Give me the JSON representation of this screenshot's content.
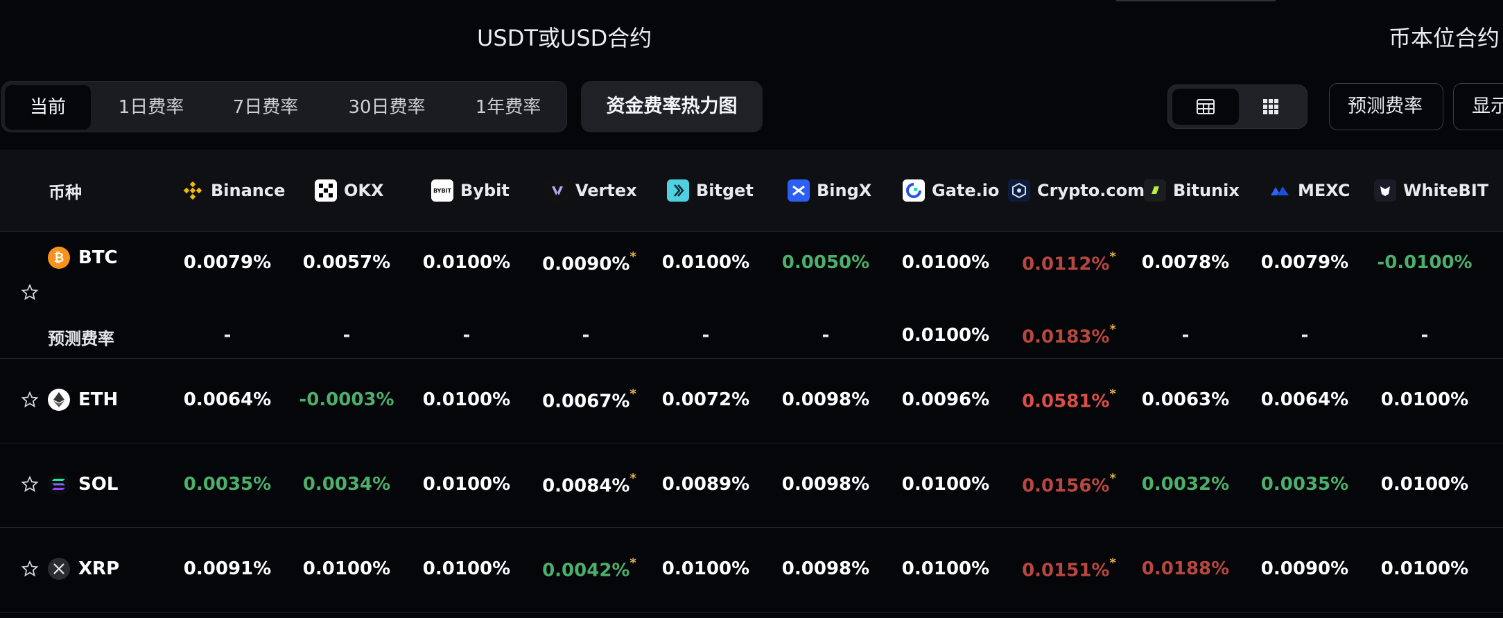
{
  "titles": {
    "usdt": "USDT或USD合约",
    "coin": "币本位合约"
  },
  "period_tabs": [
    "当前",
    "1日费率",
    "7日费率",
    "30日费率",
    "1年费率"
  ],
  "heatmap_button": "资金费率热力图",
  "predict_button": "预测费率",
  "display_button": "显示",
  "table": {
    "coin_header": "币种",
    "exchanges": [
      {
        "name": "Binance",
        "icon": "binance-icon"
      },
      {
        "name": "OKX",
        "icon": "okx-icon"
      },
      {
        "name": "Bybit",
        "icon": "bybit-icon"
      },
      {
        "name": "Vertex",
        "icon": "vertex-icon"
      },
      {
        "name": "Bitget",
        "icon": "bitget-icon"
      },
      {
        "name": "BingX",
        "icon": "bingx-icon"
      },
      {
        "name": "Gate.io",
        "icon": "gateio-icon"
      },
      {
        "name": "Crypto.com",
        "icon": "cryptocom-icon"
      },
      {
        "name": "Bitunix",
        "icon": "bitunix-icon"
      },
      {
        "name": "MEXC",
        "icon": "mexc-icon"
      },
      {
        "name": "WhiteBIT",
        "icon": "whitebit-icon"
      }
    ],
    "predict_label": "预测费率",
    "rows": [
      {
        "symbol": "BTC",
        "rates": [
          "0.0079%",
          "0.0057%",
          "0.0100%",
          "0.0090%",
          "0.0100%",
          "0.0050%",
          "0.0100%",
          "0.0112%",
          "0.0078%",
          "0.0079%",
          "-0.0100%"
        ],
        "predicted": [
          "-",
          "-",
          "-",
          "-",
          "-",
          "-",
          "0.0100%",
          "0.0183%",
          "-",
          "-",
          "-"
        ]
      },
      {
        "symbol": "ETH",
        "rates": [
          "0.0064%",
          "-0.0003%",
          "0.0100%",
          "0.0067%",
          "0.0072%",
          "0.0098%",
          "0.0096%",
          "0.0581%",
          "0.0063%",
          "0.0064%",
          "0.0100%"
        ]
      },
      {
        "symbol": "SOL",
        "rates": [
          "0.0035%",
          "0.0034%",
          "0.0100%",
          "0.0084%",
          "0.0089%",
          "0.0098%",
          "0.0100%",
          "0.0156%",
          "0.0032%",
          "0.0035%",
          "0.0100%"
        ]
      },
      {
        "symbol": "XRP",
        "rates": [
          "0.0091%",
          "0.0100%",
          "0.0100%",
          "0.0042%",
          "0.0100%",
          "0.0098%",
          "0.0100%",
          "0.0151%",
          "0.0188%",
          "0.0090%",
          "0.0100%"
        ]
      }
    ]
  }
}
